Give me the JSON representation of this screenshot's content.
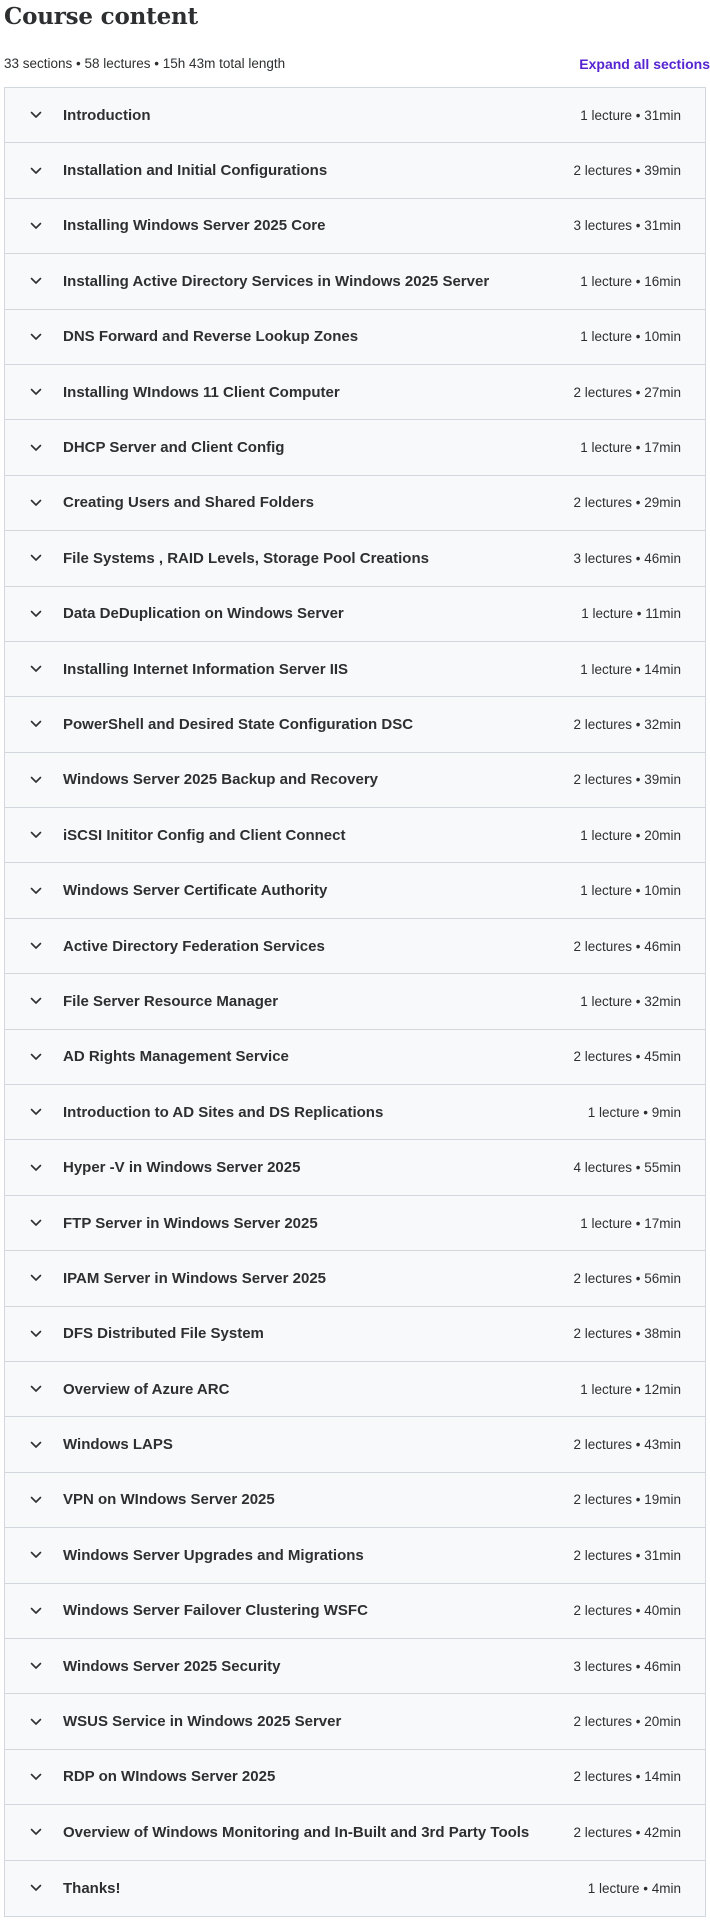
{
  "header": {
    "title": "Course content",
    "summary": "33 sections • 58 lectures • 15h 43m total length",
    "expand_label": "Expand all sections"
  },
  "icons": {
    "section_toggle": "chevron-down-icon"
  },
  "colors": {
    "accent": "#5624d0",
    "section_bg": "#f7f9fa",
    "border": "#d1d7dc",
    "text": "#2d2f31"
  },
  "sections": [
    {
      "title": "Introduction",
      "info": "1 lecture • 31min"
    },
    {
      "title": "Installation and Initial Configurations",
      "info": "2 lectures • 39min"
    },
    {
      "title": "Installing Windows Server 2025 Core",
      "info": "3 lectures • 31min"
    },
    {
      "title": "Installing Active Directory Services in Windows 2025 Server",
      "info": "1 lecture • 16min"
    },
    {
      "title": "DNS Forward and Reverse Lookup Zones",
      "info": "1 lecture • 10min"
    },
    {
      "title": "Installing WIndows 11 Client Computer",
      "info": "2 lectures • 27min"
    },
    {
      "title": "DHCP Server and Client Config",
      "info": "1 lecture • 17min"
    },
    {
      "title": "Creating Users and Shared Folders",
      "info": "2 lectures • 29min"
    },
    {
      "title": "File Systems , RAID Levels, Storage Pool Creations",
      "info": "3 lectures • 46min"
    },
    {
      "title": "Data DeDuplication on Windows Server",
      "info": "1 lecture • 11min"
    },
    {
      "title": "Installing Internet Information Server IIS",
      "info": "1 lecture • 14min"
    },
    {
      "title": "PowerShell and Desired State Configuration DSC",
      "info": "2 lectures • 32min"
    },
    {
      "title": "Windows Server 2025 Backup and Recovery",
      "info": "2 lectures • 39min"
    },
    {
      "title": "iSCSI Inititor Config and Client Connect",
      "info": "1 lecture • 20min"
    },
    {
      "title": "Windows Server Certificate Authority",
      "info": "1 lecture • 10min"
    },
    {
      "title": "Active Directory Federation Services",
      "info": "2 lectures • 46min"
    },
    {
      "title": "File Server Resource Manager",
      "info": "1 lecture • 32min"
    },
    {
      "title": "AD Rights Management Service",
      "info": "2 lectures • 45min"
    },
    {
      "title": "Introduction to AD Sites and DS Replications",
      "info": "1 lecture • 9min"
    },
    {
      "title": "Hyper -V in Windows Server 2025",
      "info": "4 lectures • 55min"
    },
    {
      "title": "FTP Server in Windows Server 2025",
      "info": "1 lecture • 17min"
    },
    {
      "title": "IPAM Server in Windows Server 2025",
      "info": "2 lectures • 56min"
    },
    {
      "title": "DFS Distributed File System",
      "info": "2 lectures • 38min"
    },
    {
      "title": "Overview of Azure ARC",
      "info": "1 lecture • 12min"
    },
    {
      "title": "Windows LAPS",
      "info": "2 lectures • 43min"
    },
    {
      "title": "VPN on WIndows Server 2025",
      "info": "2 lectures • 19min"
    },
    {
      "title": "Windows Server Upgrades and Migrations",
      "info": "2 lectures • 31min"
    },
    {
      "title": "Windows Server Failover Clustering WSFC",
      "info": "2 lectures • 40min"
    },
    {
      "title": "Windows Server 2025 Security",
      "info": "3 lectures • 46min"
    },
    {
      "title": "WSUS Service in Windows 2025 Server",
      "info": "2 lectures • 20min"
    },
    {
      "title": "RDP on WIndows Server 2025",
      "info": "2 lectures • 14min"
    },
    {
      "title": "Overview of Windows Monitoring and In-Built and 3rd Party Tools",
      "info": "2 lectures • 42min"
    },
    {
      "title": "Thanks!",
      "info": "1 lecture • 4min"
    }
  ]
}
